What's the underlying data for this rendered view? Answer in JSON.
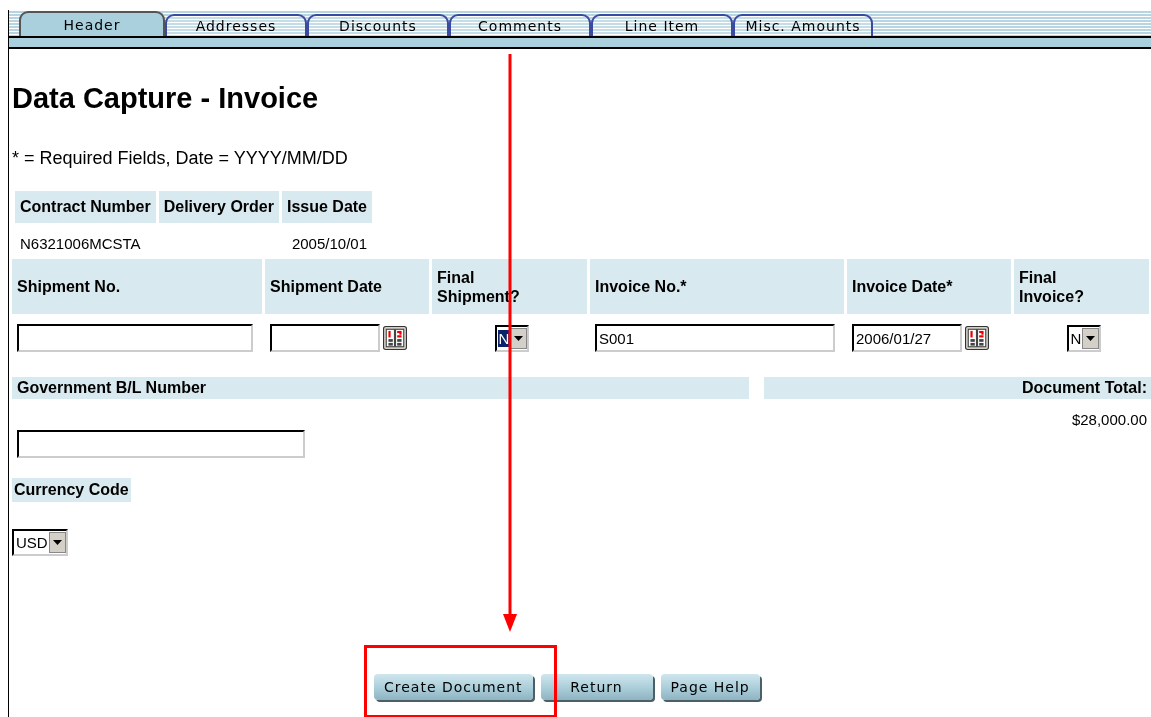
{
  "tabs": [
    {
      "label": "Header",
      "selected": true
    },
    {
      "label": "Addresses",
      "selected": false
    },
    {
      "label": "Discounts",
      "selected": false
    },
    {
      "label": "Comments",
      "selected": false
    },
    {
      "label": "Line Item",
      "selected": false
    },
    {
      "label": "Misc. Amounts",
      "selected": false
    }
  ],
  "title": "Data Capture - Invoice",
  "note": "* = Required Fields, Date = YYYY/MM/DD",
  "contract_table": {
    "columns": [
      "Contract Number",
      "Delivery Order",
      "Issue Date"
    ],
    "row": {
      "contract_number": "N6321006MCSTA",
      "issue_date": "2005/10/01"
    }
  },
  "fields": [
    {
      "kind": "text",
      "label": "Shipment No."
    },
    {
      "kind": "date",
      "label": "Shipment Date"
    },
    {
      "kind": "select",
      "label": "Final Shipment?",
      "value": "N",
      "focused": true
    },
    {
      "kind": "text",
      "label": "Invoice No.*",
      "value": "S001"
    },
    {
      "kind": "date",
      "label": "Invoice Date*",
      "value": "2006/01/27"
    },
    {
      "kind": "select",
      "label": "Final Invoice?",
      "value": "N",
      "focused": false
    }
  ],
  "government_bl": {
    "label": "Government B/L Number"
  },
  "document_total": {
    "label": "Document Total:",
    "value": "$28,000.00"
  },
  "currency": {
    "label": "Currency Code",
    "value": "USD"
  },
  "buttons": [
    {
      "label": "Create Document"
    },
    {
      "label": "Return"
    },
    {
      "label": "Page Help"
    }
  ],
  "annotations": {
    "arrow": true,
    "highlight_box": true
  }
}
